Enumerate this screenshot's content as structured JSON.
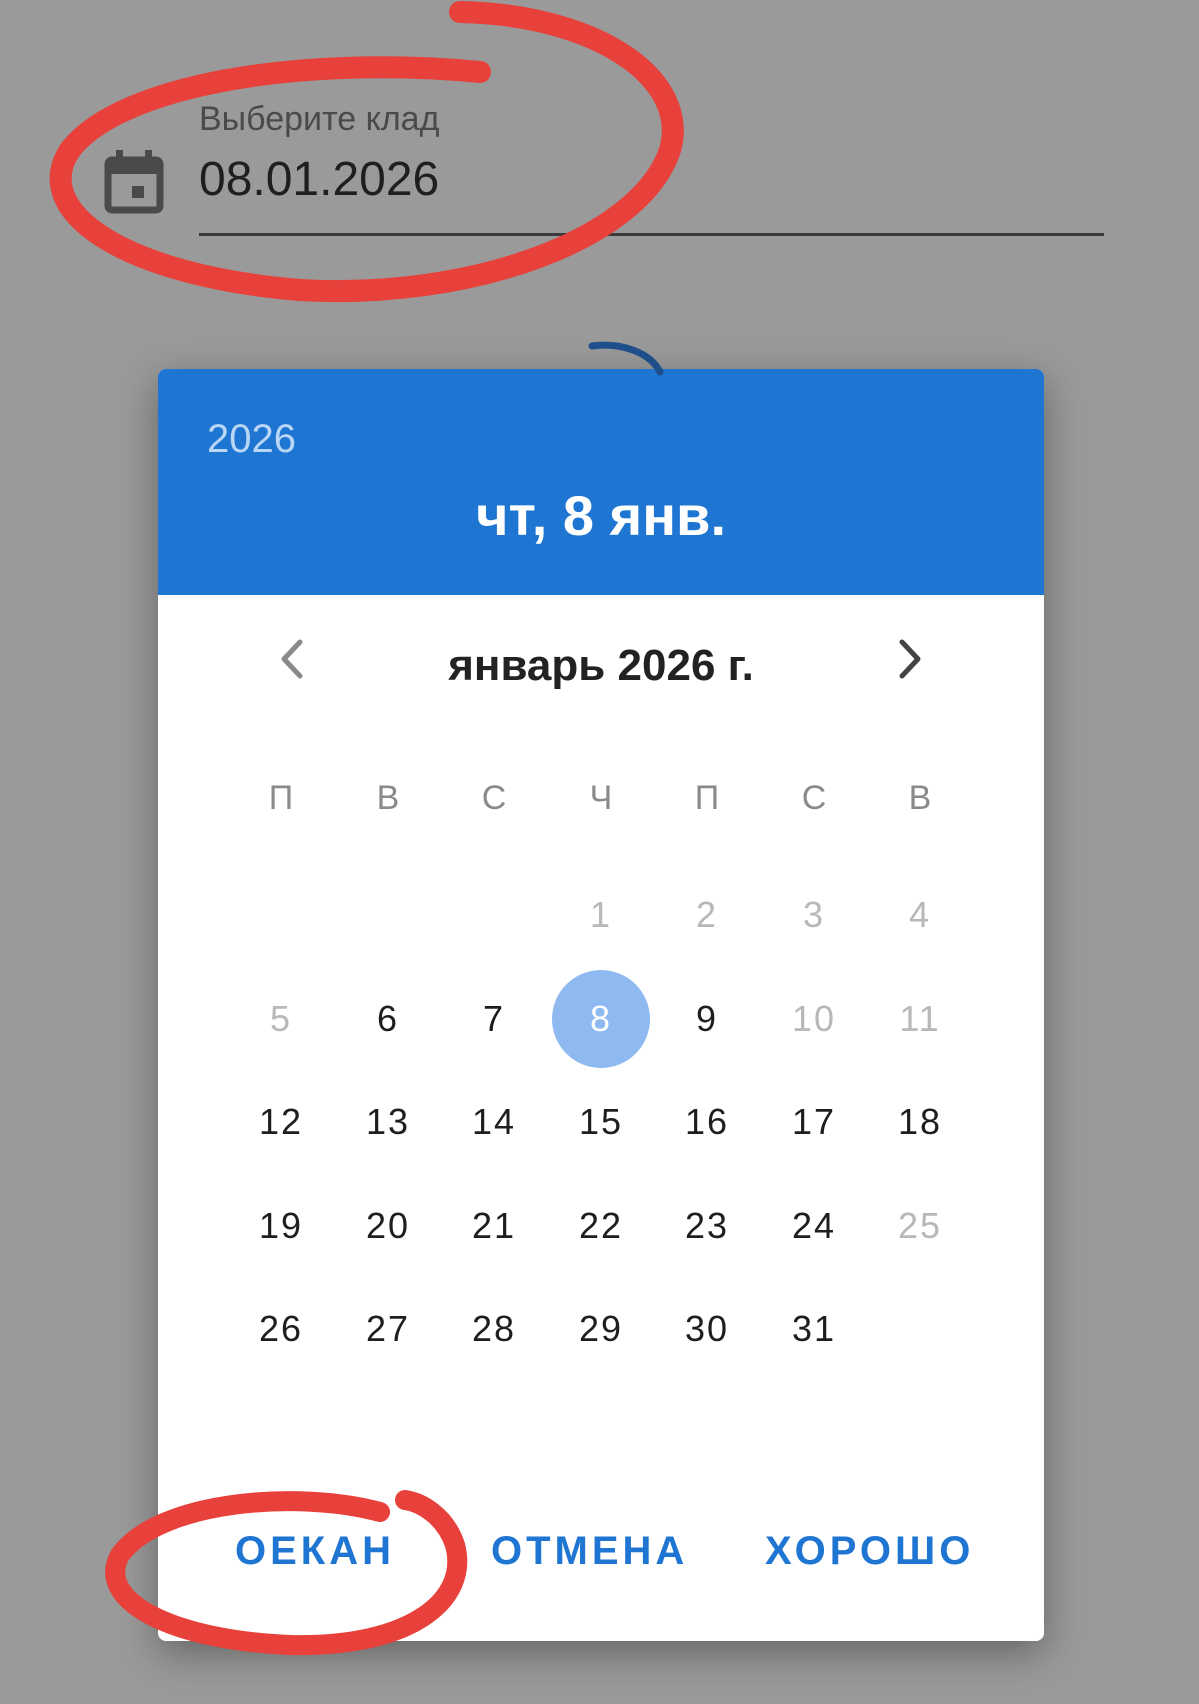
{
  "field": {
    "label": "Выберите клад",
    "value": "08.01.2026",
    "icon": "calendar-icon"
  },
  "dialog": {
    "year": "2026",
    "selected_date": "чт, 8 янв.",
    "month_title": "январь 2026 г.",
    "prev_icon": "chevron-left-icon",
    "next_icon": "chevron-right-icon",
    "weekdays": [
      "П",
      "В",
      "С",
      "Ч",
      "П",
      "С",
      "В"
    ],
    "weeks": [
      [
        "",
        "",
        "",
        "1",
        "2",
        "3",
        "4"
      ],
      [
        "5",
        "6",
        "7",
        "8",
        "9",
        "10",
        "11"
      ],
      [
        "12",
        "13",
        "14",
        "15",
        "16",
        "17",
        "18"
      ],
      [
        "19",
        "20",
        "21",
        "22",
        "23",
        "24",
        "25"
      ],
      [
        "26",
        "27",
        "28",
        "29",
        "30",
        "31",
        ""
      ]
    ],
    "muted_days": [
      "1",
      "2",
      "3",
      "4",
      "5",
      "10",
      "11",
      "25"
    ],
    "selected_day": "8",
    "actions": {
      "ocean": "ОЕКАН",
      "cancel": "ОТМЕНА",
      "ok": "ХОРОШО"
    }
  },
  "colors": {
    "accent": "#1f76d2",
    "header_year": "#b9d6f5",
    "selected_circle": "#8fb9f1",
    "annotation": "#e8403a",
    "backdrop": "#9a9a9a"
  }
}
